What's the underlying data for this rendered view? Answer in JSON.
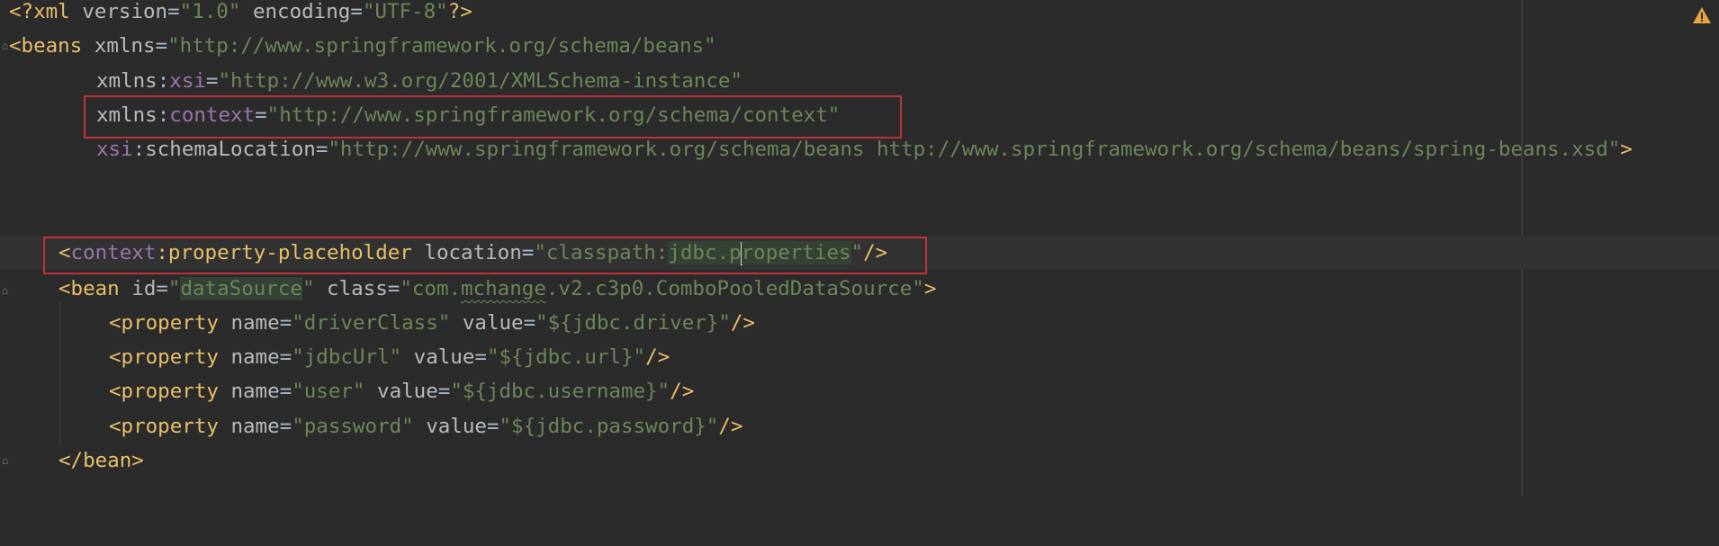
{
  "editor": {
    "warning_icon": "warning-triangle-icon",
    "colors": {
      "background": "#2b2b2b",
      "tag": "#e8bf6a",
      "namespace": "#9876aa",
      "attribute": "#bababa",
      "value": "#6a8759",
      "highlight_box": "#c0313a",
      "warning": "#e8a33d"
    },
    "lines": {
      "l1": {
        "open": "<?",
        "tag": "xml",
        "a1": "version",
        "v1": "\"1.0\"",
        "a2": "encoding",
        "v2": "\"UTF-8\"",
        "close": "?>"
      },
      "l2": {
        "open": "<",
        "tag": "beans",
        "a1": "xmlns",
        "eq": "=",
        "v1": "\"http://www.springframework.org/schema/beans\""
      },
      "l3": {
        "a1": "xmlns",
        "colon": ":",
        "ns": "xsi",
        "eq": "=",
        "v1": "\"http://www.w3.org/2001/XMLSchema-instance\""
      },
      "l4": {
        "a1": "xmlns",
        "colon": ":",
        "ns": "context",
        "eq": "=",
        "v1": "\"http://www.springframework.org/schema/context\""
      },
      "l5": {
        "ns": "xsi",
        "colon": ":",
        "a1": "schemaLocation",
        "eq": "=",
        "v1": "\"http://www.springframework.org/schema/beans http://www.springframework.org/schema/beans/spring-beans.xsd\"",
        "close": ">"
      },
      "l8": {
        "open": "<",
        "ns": "context",
        "colon": ":",
        "tag": "property-placeholder",
        "a1": "location",
        "eq": "=",
        "q": "\"",
        "v1a": "classpath:",
        "v1b": "jdbc.p",
        "v1c": "roperties",
        "q2": "\"",
        "close": "/>"
      },
      "l9": {
        "open": "<",
        "tag": "bean",
        "a1": "id",
        "eq": "=",
        "q": "\"",
        "v1": "dataSource",
        "q2": "\"",
        "a2": "class",
        "v2a": "\"com.",
        "v2b": "mchange",
        "v2c": ".v2.c3p0.ComboPooledDataSource\"",
        "close": ">"
      },
      "props": [
        {
          "name": "\"driverClass\"",
          "value": "\"${jdbc.driver}\""
        },
        {
          "name": "\"jdbcUrl\"",
          "value": "\"${jdbc.url}\""
        },
        {
          "name": "\"user\"",
          "value": "\"${jdbc.username}\""
        },
        {
          "name": "\"password\"",
          "value": "\"${jdbc.password}\""
        }
      ],
      "prop_tag": "property",
      "prop_attr_name": "name",
      "prop_attr_value": "value",
      "lt": "<",
      "eq": "=",
      "self_close": "/>",
      "l14": {
        "open": "</",
        "tag": "bean",
        "close": ">"
      }
    }
  }
}
